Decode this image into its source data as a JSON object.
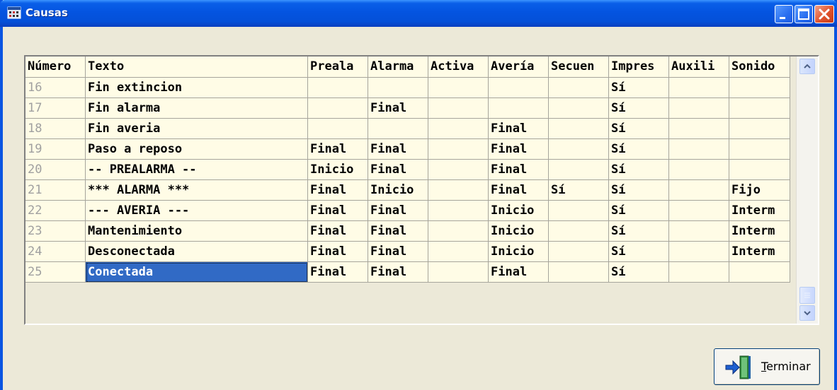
{
  "window": {
    "title": "Causas"
  },
  "grid": {
    "columns": [
      "Número",
      "Texto",
      "Preala",
      "Alarma",
      "Activa",
      "Avería",
      "Secuen",
      "Impres",
      "Auxili",
      "Sonido"
    ],
    "rows": [
      [
        "16",
        "Fin extincion",
        "",
        "",
        "",
        "",
        "",
        "Sí",
        "",
        ""
      ],
      [
        "17",
        "Fin alarma",
        "",
        "Final",
        "",
        "",
        "",
        "Sí",
        "",
        ""
      ],
      [
        "18",
        "Fin averia",
        "",
        "",
        "",
        "Final",
        "",
        "Sí",
        "",
        ""
      ],
      [
        "19",
        "Paso a reposo",
        "Final",
        "Final",
        "",
        "Final",
        "",
        "Sí",
        "",
        ""
      ],
      [
        "20",
        "-- PREALARMA --",
        "Inicio",
        "Final",
        "",
        "Final",
        "",
        "Sí",
        "",
        ""
      ],
      [
        "21",
        "*** ALARMA ***",
        "Final",
        "Inicio",
        "",
        "Final",
        "Sí",
        "Sí",
        "",
        "Fijo"
      ],
      [
        "22",
        "--- AVERIA ---",
        "Final",
        "Final",
        "",
        "Inicio",
        "",
        "Sí",
        "",
        "Interm"
      ],
      [
        "23",
        "Mantenimiento",
        "Final",
        "Final",
        "",
        "Inicio",
        "",
        "Sí",
        "",
        "Interm"
      ],
      [
        "24",
        "Desconectada",
        "Final",
        "Final",
        "",
        "Inicio",
        "",
        "Sí",
        "",
        "Interm"
      ],
      [
        "25",
        "Conectada",
        "Final",
        "Final",
        "",
        "Final",
        "",
        "Sí",
        "",
        ""
      ]
    ],
    "selected": {
      "row": 9,
      "col": 1
    }
  },
  "buttons": {
    "terminar_first": "T",
    "terminar_rest": "erminar"
  },
  "colors": {
    "title_bar": "#0454e0",
    "selection": "#316ac5",
    "cell_bg": "#fffce6",
    "row_number": "#a0a0a0"
  },
  "icons": {
    "app": "app-window-icon",
    "terminar": "exit-door-icon"
  }
}
